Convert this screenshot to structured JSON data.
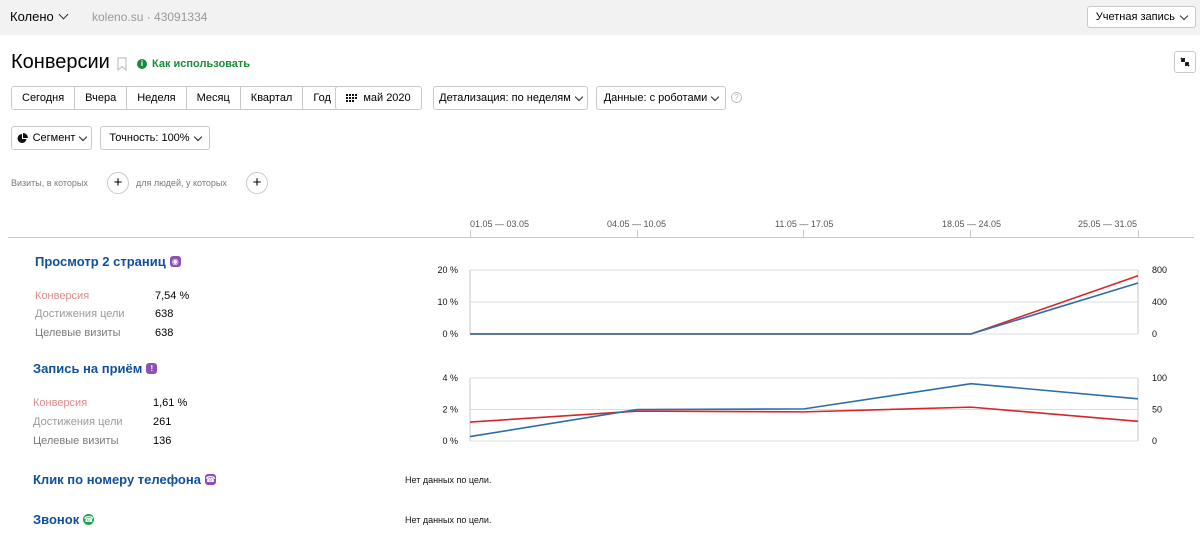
{
  "topbar": {
    "counter_name": "Колено",
    "counter_meta": "koleno.su · 43091334",
    "account_label": "Учетная запись"
  },
  "header": {
    "title": "Конверсии",
    "howto_label": "Как использовать"
  },
  "toolbar": {
    "periods": [
      "Сегодня",
      "Вчера",
      "Неделя",
      "Месяц",
      "Квартал",
      "Год"
    ],
    "date_range": "май 2020",
    "detail_label": "Детализация: по неделям",
    "data_label": "Данные: с роботами",
    "segment_label": "Сегмент",
    "accuracy_label": "Точность: 100%",
    "help": "?"
  },
  "filters": {
    "visits_text": "Визиты, в которых",
    "people_text": "для людей, у которых",
    "add": "+"
  },
  "timeline": {
    "periods": [
      "01.05 — 03.05",
      "04.05 — 10.05",
      "11.05 — 17.05",
      "18.05 — 24.05",
      "25.05 — 31.05"
    ]
  },
  "labels": {
    "conversion": "Конверсия",
    "reaches": "Достижения цели",
    "visits": "Целевые визиты"
  },
  "goals": [
    {
      "title": "Просмотр 2 страниц",
      "conversion": "7,54 %",
      "reaches": "638",
      "visits": "638"
    },
    {
      "title": "Запись на приём",
      "conversion": "1,61 %",
      "reaches": "261",
      "visits": "136"
    },
    {
      "title": "Клик по номеру телефона",
      "nodata": "Нет данных по цели."
    },
    {
      "title": "Звонок",
      "nodata": "Нет данных по цели."
    }
  ],
  "colors": {
    "conversion_line": "#d8242d",
    "reaches_line": "#2b6ea8",
    "link": "#0e4f9e",
    "green": "#1fa34a"
  },
  "chart_data": [
    {
      "type": "line",
      "goal": "Просмотр 2 страниц",
      "categories": [
        "01.05 — 03.05",
        "04.05 — 10.05",
        "11.05 — 17.05",
        "18.05 — 24.05",
        "25.05 — 31.05"
      ],
      "left_axis_ticks": [
        "0 %",
        "10 %",
        "20 %"
      ],
      "right_axis_ticks": [
        "0",
        "400",
        "800"
      ],
      "ylim_left": [
        0,
        20
      ],
      "ylim_right": [
        0,
        800
      ],
      "series": [
        {
          "axis": "left",
          "color": "#d8242d",
          "values": [
            0,
            0,
            0,
            0,
            18.2
          ]
        },
        {
          "axis": "right",
          "color": "#2b6ea8",
          "values": [
            0,
            0,
            0,
            0,
            638
          ]
        }
      ]
    },
    {
      "type": "line",
      "goal": "Запись на приём",
      "categories": [
        "01.05 — 03.05",
        "04.05 — 10.05",
        "11.05 — 17.05",
        "18.05 — 24.05",
        "25.05 — 31.05"
      ],
      "left_axis_ticks": [
        "0 %",
        "2 %",
        "4 %"
      ],
      "right_axis_ticks": [
        "0",
        "50",
        "100"
      ],
      "ylim_left": [
        0,
        4
      ],
      "ylim_right": [
        0,
        100
      ],
      "series": [
        {
          "axis": "left",
          "color": "#d8242d",
          "values": [
            1.2,
            1.9,
            1.85,
            2.15,
            1.25
          ]
        },
        {
          "axis": "right",
          "color": "#2b6ea8",
          "values": [
            7,
            50,
            51,
            91,
            67
          ]
        }
      ]
    }
  ]
}
